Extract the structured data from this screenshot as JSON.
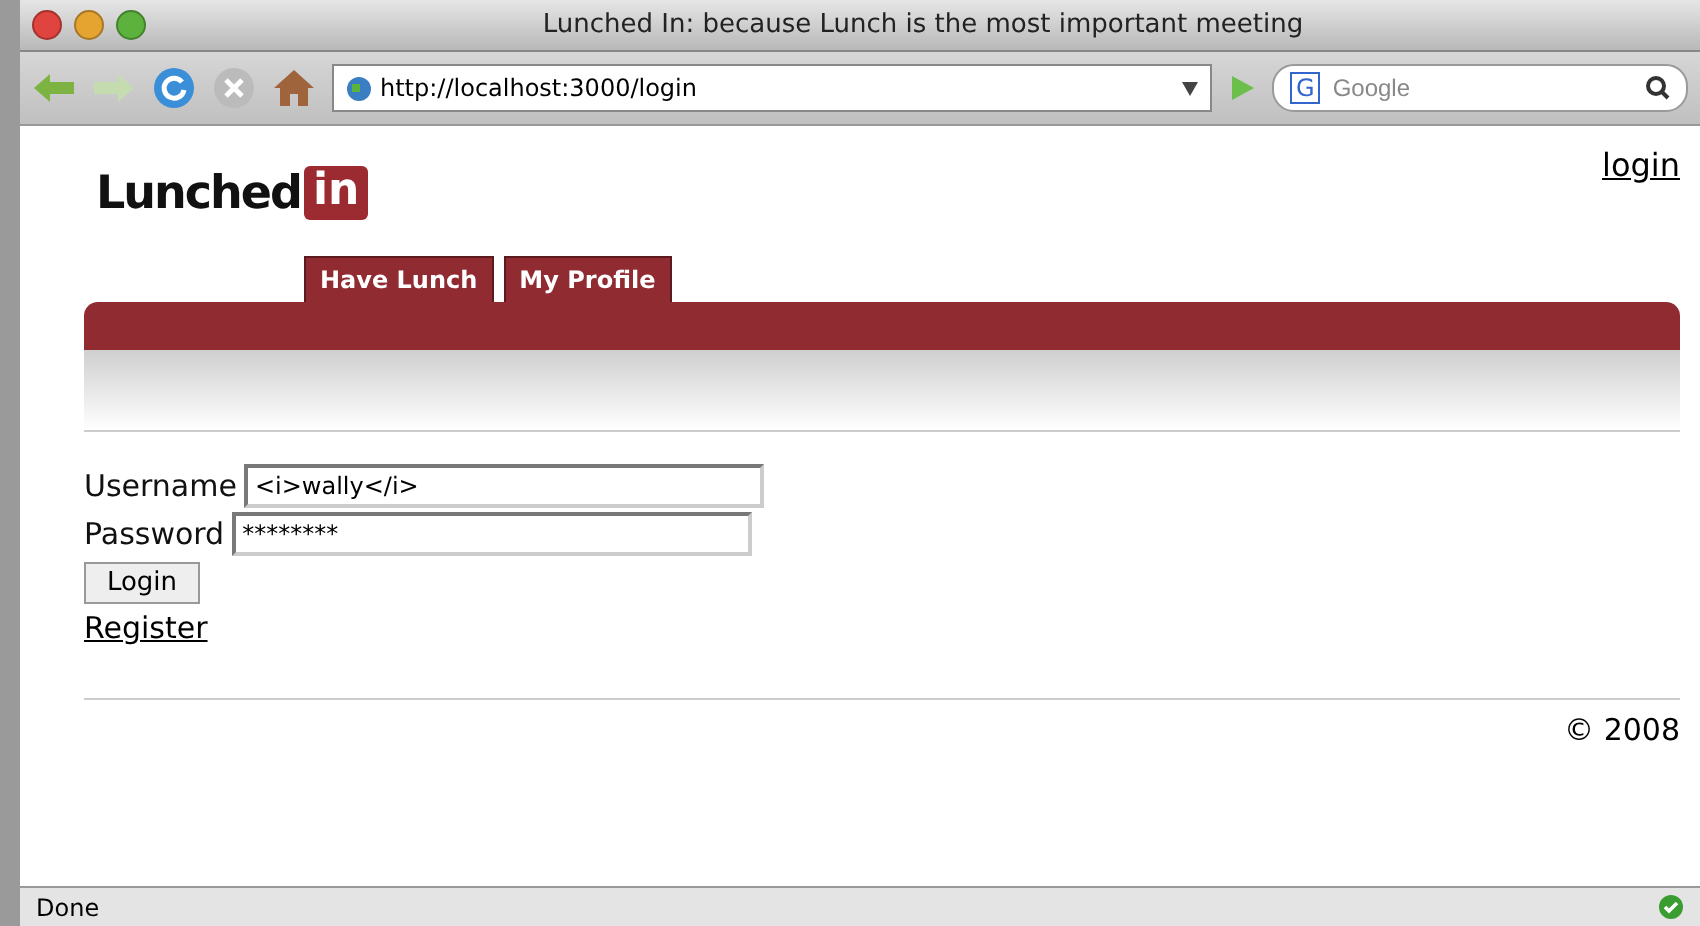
{
  "window": {
    "title": "Lunched In: because Lunch is the most important meeting"
  },
  "toolbar": {
    "url": "http://localhost:3000/login",
    "search": {
      "engine_letter": "G",
      "placeholder": "Google"
    }
  },
  "header": {
    "logo": {
      "word": "Lunched",
      "badge": "in"
    },
    "login_link": "login"
  },
  "tabs": [
    {
      "label": "Have Lunch"
    },
    {
      "label": "My Profile"
    }
  ],
  "form": {
    "fields": [
      {
        "label": "Username",
        "value": "<i>wally</i>"
      },
      {
        "label": "Password",
        "value": "********"
      }
    ],
    "submit": "Login",
    "register_link": "Register"
  },
  "footer": "© 2008",
  "status_bar": {
    "text": "Done"
  }
}
